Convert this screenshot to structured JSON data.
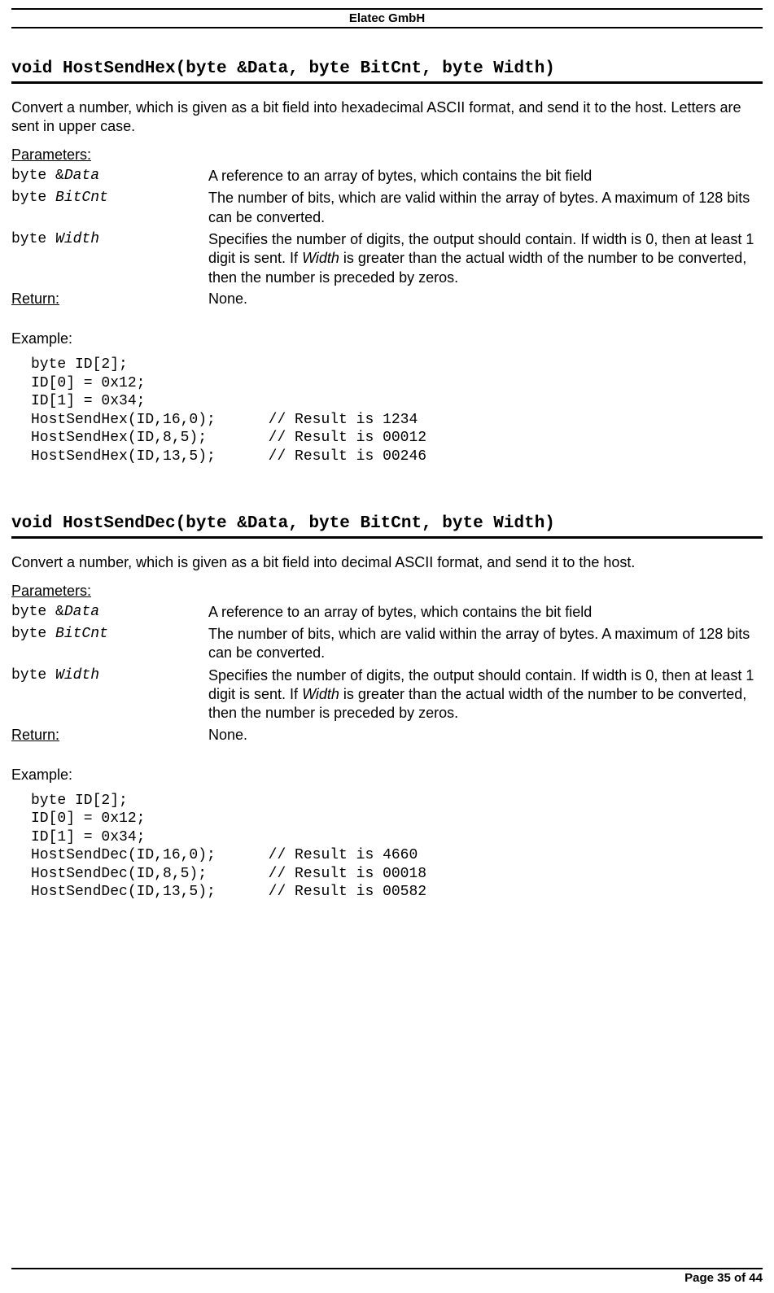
{
  "header": {
    "company": "Elatec GmbH"
  },
  "functions": [
    {
      "signature": "void HostSendHex(byte &Data, byte BitCnt, byte Width)",
      "description": "Convert a number, which is given as a bit field into hexadecimal ASCII format, and send it to the host. Letters are sent in upper case.",
      "param_heading": "Parameters:",
      "params": [
        {
          "name_plain": "byte &",
          "name_italic": "Data",
          "desc_pre": "A reference to an array of bytes, which contains the bit field",
          "desc_it": "",
          "desc_post": ""
        },
        {
          "name_plain": "byte ",
          "name_italic": "BitCnt",
          "desc_pre": "The number of bits, which are valid within the array of bytes. A maximum of 128 bits can be converted.",
          "desc_it": "",
          "desc_post": ""
        },
        {
          "name_plain": "byte ",
          "name_italic": "Width",
          "desc_pre": "Specifies the number of digits, the output should contain. If width is 0, then at least 1 digit is sent. If ",
          "desc_it": "Width",
          "desc_post": " is greater than the actual width of the number to be converted, then the number is preceded by zeros."
        }
      ],
      "return_label": "Return:",
      "return_value": "None.",
      "example_label": "Example:",
      "code": "byte ID[2];\nID[0] = 0x12;\nID[1] = 0x34;\nHostSendHex(ID,16,0);      // Result is 1234\nHostSendHex(ID,8,5);       // Result is 00012\nHostSendHex(ID,13,5);      // Result is 00246"
    },
    {
      "signature": "void HostSendDec(byte &Data, byte BitCnt, byte Width)",
      "description": "Convert a number, which is given as a bit field into decimal ASCII format, and send it to the host.",
      "param_heading": "Parameters:",
      "params": [
        {
          "name_plain": "byte &",
          "name_italic": "Data",
          "desc_pre": "A reference to an array of bytes, which contains the bit field",
          "desc_it": "",
          "desc_post": ""
        },
        {
          "name_plain": "byte ",
          "name_italic": "BitCnt",
          "desc_pre": "The number of bits, which are valid within the array of bytes. A maximum of 128 bits can be converted.",
          "desc_it": "",
          "desc_post": ""
        },
        {
          "name_plain": "byte ",
          "name_italic": "Width",
          "desc_pre": "Specifies the number of digits, the output should contain. If width is 0, then at least 1 digit is sent. If ",
          "desc_it": "Width",
          "desc_post": " is greater than the actual width of the number to be converted, then the number is preceded by zeros."
        }
      ],
      "return_label": "Return:",
      "return_value": "None.",
      "example_label": "Example:",
      "code": "byte ID[2];\nID[0] = 0x12;\nID[1] = 0x34;\nHostSendDec(ID,16,0);      // Result is 4660\nHostSendDec(ID,8,5);       // Result is 00018\nHostSendDec(ID,13,5);      // Result is 00582"
    }
  ],
  "footer": {
    "page": "Page 35 of 44"
  }
}
